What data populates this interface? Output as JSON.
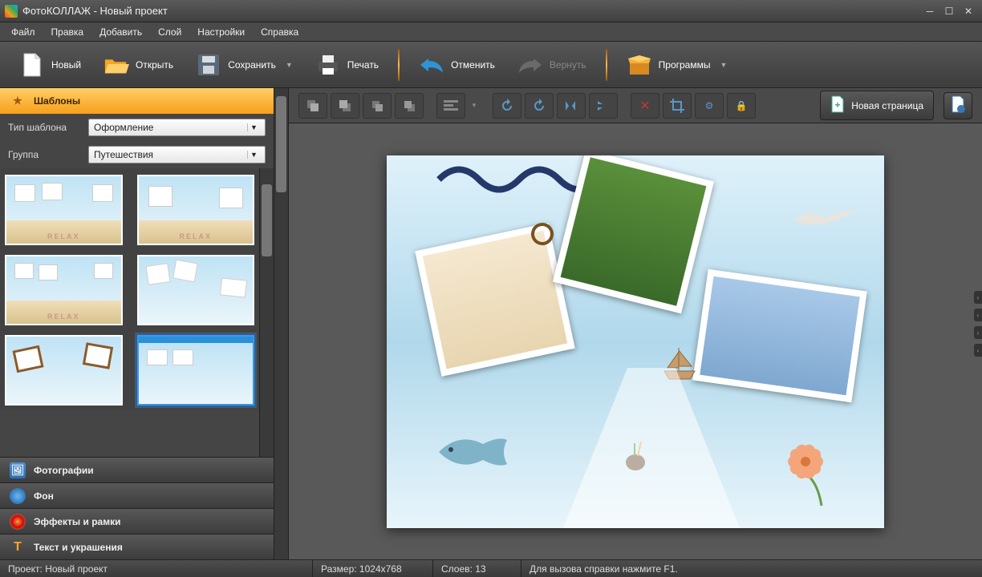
{
  "window": {
    "title": "ФотоКОЛЛАЖ - Новый проект"
  },
  "menu": {
    "file": "Файл",
    "edit": "Правка",
    "add": "Добавить",
    "layer": "Слой",
    "settings": "Настройки",
    "help": "Справка"
  },
  "toolbar": {
    "new": "Новый",
    "open": "Открыть",
    "save": "Сохранить",
    "print": "Печать",
    "undo": "Отменить",
    "redo": "Вернуть",
    "programs": "Программы"
  },
  "sidebar": {
    "templates": "Шаблоны",
    "type_label": "Тип шаблона",
    "type_value": "Оформление",
    "group_label": "Группа",
    "group_value": "Путешествия",
    "tabs": {
      "photos": "Фотографии",
      "background": "Фон",
      "effects": "Эффекты и рамки",
      "text": "Текст и украшения"
    }
  },
  "editor": {
    "new_page": "Новая страница"
  },
  "status": {
    "project_label": "Проект:",
    "project_value": "Новый проект",
    "size_label": "Размер:",
    "size_value": "1024x768",
    "layers_label": "Слоев:",
    "layers_value": "13",
    "help_hint": "Для вызова справки нажмите F1."
  }
}
